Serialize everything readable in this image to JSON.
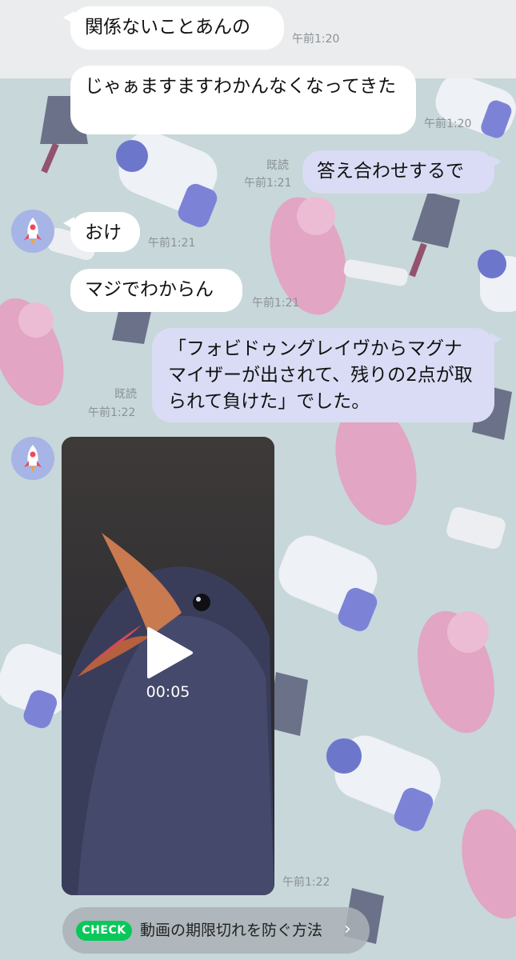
{
  "messages": [
    {
      "text": "関係ないことあんの",
      "time": "午前1:20",
      "side": "in"
    },
    {
      "text": "じゃぁますますわかんなくなってきた",
      "time": "午前1:20",
      "side": "in"
    },
    {
      "text": "答え合わせするで",
      "read": "既読",
      "time": "午前1:21",
      "side": "out"
    },
    {
      "text": "おけ",
      "time": "午前1:21",
      "side": "in"
    },
    {
      "text": "マジでわからん",
      "time": "午前1:21",
      "side": "in"
    },
    {
      "text": "「フォビドゥングレイヴからマグナマイザーが出されて、残りの2点が取られて負けた」でした。",
      "read": "既読",
      "time": "午前1:22",
      "side": "out"
    }
  ],
  "video": {
    "duration": "00:05",
    "time": "午前1:22"
  },
  "check_banner": {
    "badge": "CHECK",
    "text": "動画の期限切れを防ぐ方法",
    "chevron": "›"
  },
  "icons": {
    "avatar": "rocket-icon",
    "play": "play-icon"
  }
}
